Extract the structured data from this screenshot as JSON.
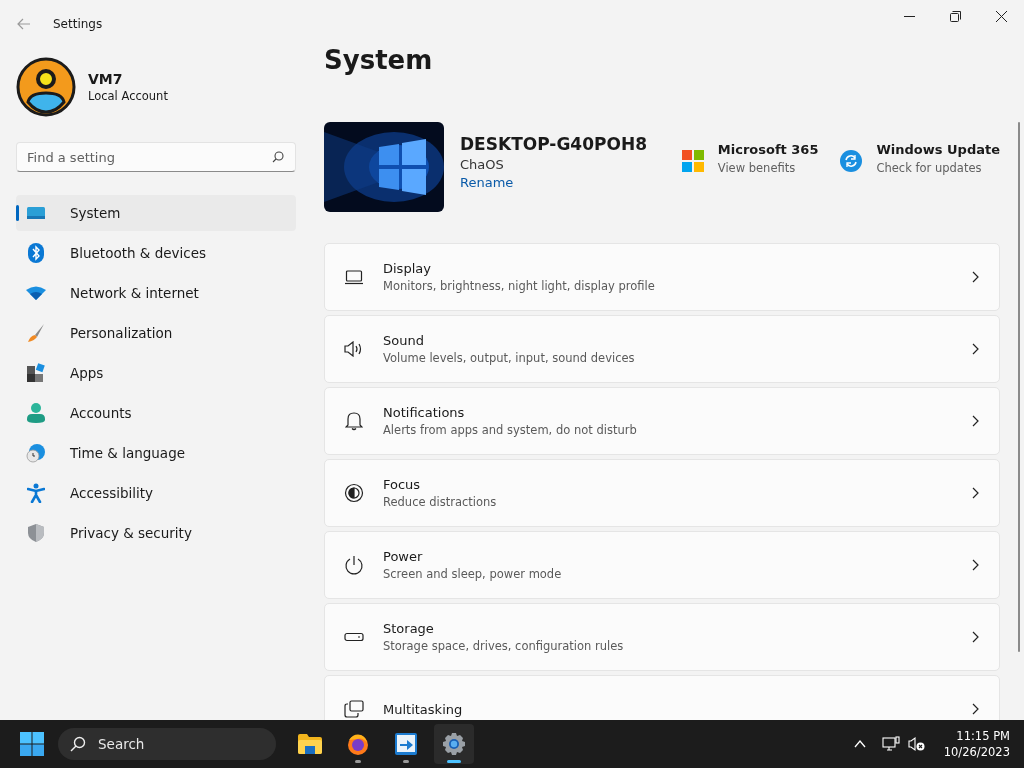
{
  "window": {
    "title": "Settings"
  },
  "user": {
    "name": "VM7",
    "account": "Local Account"
  },
  "search": {
    "placeholder": "Find a setting"
  },
  "nav": [
    {
      "label": "System",
      "selected": true
    },
    {
      "label": "Bluetooth & devices",
      "selected": false
    },
    {
      "label": "Network & internet",
      "selected": false
    },
    {
      "label": "Personalization",
      "selected": false
    },
    {
      "label": "Apps",
      "selected": false
    },
    {
      "label": "Accounts",
      "selected": false
    },
    {
      "label": "Time & language",
      "selected": false
    },
    {
      "label": "Accessibility",
      "selected": false
    },
    {
      "label": "Privacy & security",
      "selected": false
    }
  ],
  "page": {
    "title": "System"
  },
  "device": {
    "name": "DESKTOP-G40POH8",
    "os": "ChaOS",
    "rename": "Rename"
  },
  "quick_links": [
    {
      "title": "Microsoft 365",
      "subtitle": "View benefits"
    },
    {
      "title": "Windows Update",
      "subtitle": "Check for updates"
    }
  ],
  "settings": [
    {
      "title": "Display",
      "description": "Monitors, brightness, night light, display profile"
    },
    {
      "title": "Sound",
      "description": "Volume levels, output, input, sound devices"
    },
    {
      "title": "Notifications",
      "description": "Alerts from apps and system, do not disturb"
    },
    {
      "title": "Focus",
      "description": "Reduce distractions"
    },
    {
      "title": "Power",
      "description": "Screen and sleep, power mode"
    },
    {
      "title": "Storage",
      "description": "Storage space, drives, configuration rules"
    },
    {
      "title": "Multitasking"
    }
  ],
  "taskbar": {
    "search_placeholder": "Search",
    "apps": [
      {
        "running": false,
        "selected": false
      },
      {
        "running": true,
        "selected": false
      },
      {
        "running": true,
        "selected": false
      },
      {
        "running": true,
        "selected": true
      }
    ],
    "time": "11:15 PM",
    "date": "10/26/2023"
  }
}
